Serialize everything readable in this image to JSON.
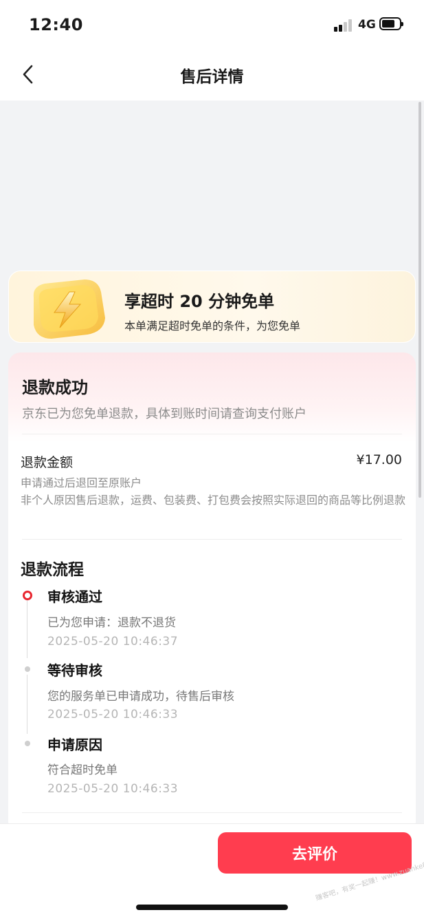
{
  "status_bar": {
    "time": "12:40",
    "network": "4G"
  },
  "nav": {
    "title": "售后详情"
  },
  "promo": {
    "title": "享超时 20 分钟免单",
    "subtitle": "本单满足超时免单的条件，为您免单"
  },
  "refund": {
    "status_title": "退款成功",
    "status_desc": "京东已为您免单退款，具体到账时间请查询支付账户",
    "amount_label": "退款金额",
    "amount_value": "¥17.00",
    "note_1": "申请通过后退回至原账户",
    "note_2": "非个人原因售后退款，运费、包装费、打包费会按照实际退回的商品等比例退款"
  },
  "flow": {
    "title": "退款流程",
    "steps": [
      {
        "title": "审核通过",
        "desc": "已为您申请：退款不退货",
        "time": "2025-05-20 10:46:37",
        "active": true
      },
      {
        "title": "等待审核",
        "desc": "您的服务单已申请成功，待售后审核",
        "time": "2025-05-20 10:46:33",
        "active": false
      },
      {
        "title": "申请原因",
        "desc": "符合超时免单",
        "time": "2025-05-20 10:46:33",
        "active": false
      }
    ]
  },
  "bottom": {
    "review_label": "去评价"
  },
  "watermark": "赚客吧，有奖一起赚！www.zuanke8.com",
  "colors": {
    "accent": "#ff3d4f",
    "active_dot": "#e8262f",
    "promo_bg": "#fff4dc"
  }
}
